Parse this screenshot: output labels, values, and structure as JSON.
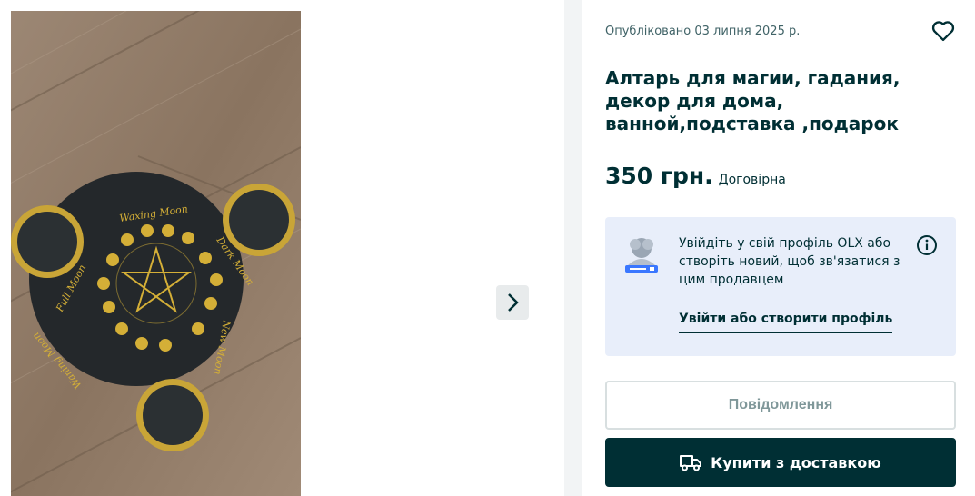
{
  "listing": {
    "published": "Опубліковано 03 липня 2025 р.",
    "title": "Алтарь для магии, гадания, декор для дома, ванной,подставка ,подарок",
    "price": "350 грн.",
    "negotiable": "Договірна"
  },
  "photo": {
    "engraved_text": [
      "Waxing Moon",
      "Full Moon",
      "Waning Moon",
      "Dark Moon",
      "New Moon"
    ]
  },
  "login_prompt": {
    "text": "Увійдіть у свій профіль OLX або створіть новий, щоб зв'язатися з цим продавцем",
    "link": "Увійти або створити профіль"
  },
  "actions": {
    "message": "Повідомлення",
    "buy": "Купити з доставкою"
  },
  "icons": [
    "chevron-right-icon",
    "heart-icon",
    "profile-illustration-icon",
    "info-icon",
    "truck-icon"
  ],
  "colors": {
    "primary": "#002f34",
    "info_bg": "#e8eefa",
    "disabled_text": "#7f9799",
    "page_bg": "#f2f4f5"
  }
}
